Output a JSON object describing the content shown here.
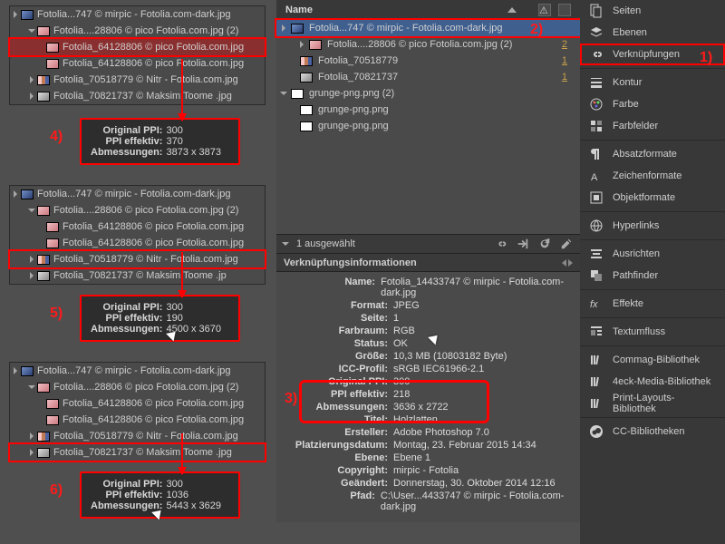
{
  "left": {
    "box1": {
      "rows": [
        {
          "t": "Fotolia...747 © mirpic - Fotolia.com-dark.jpg",
          "th": "blue",
          "disc": true
        },
        {
          "t": "Fotolia....28806 © pico Fotolia.com.jpg (2)",
          "th": "pink",
          "disc": true,
          "open": true,
          "child": true
        },
        {
          "t": "Fotolia_64128806 © pico Fotolia.com.jpg",
          "th": "pink",
          "child2": true,
          "sel": true
        },
        {
          "t": "Fotolia_64128806 © pico Fotolia.com.jpg",
          "th": "pink",
          "child2": true
        },
        {
          "t": "Fotolia_70518779 © Nitr - Fotolia.com.jpg",
          "th": "mix",
          "child": true,
          "disc": true
        },
        {
          "t": "Fotolia_70821737 © Maksim Toome .jpg",
          "th": "gray",
          "child": true,
          "disc": true
        }
      ],
      "tip": {
        "ppi": "300",
        "eff": "370",
        "dim": "3873 x 3873"
      },
      "num": "4)"
    },
    "box2": {
      "rows": [
        {
          "t": "Fotolia...747 © mirpic - Fotolia.com-dark.jpg",
          "th": "blue",
          "disc": true
        },
        {
          "t": "Fotolia....28806 © pico Fotolia.com.jpg (2)",
          "th": "pink",
          "disc": true,
          "open": true,
          "child": true
        },
        {
          "t": "Fotolia_64128806 © pico Fotolia.com.jpg",
          "th": "pink",
          "child2": true
        },
        {
          "t": "Fotolia_64128806 © pico Fotolia.com.jpg",
          "th": "pink",
          "child2": true
        },
        {
          "t": "Fotolia_70518779 © Nitr - Fotolia.com.jpg",
          "th": "mix",
          "child": true,
          "disc": true,
          "sel": true
        },
        {
          "t": "Fotolia_70821737 © Maksim Toome .jp",
          "th": "gray",
          "child": true,
          "disc": true
        }
      ],
      "tip": {
        "ppi": "300",
        "eff": "190",
        "dim": "4500 x 3670"
      },
      "num": "5)"
    },
    "box3": {
      "rows": [
        {
          "t": "Fotolia...747 © mirpic - Fotolia.com-dark.jpg",
          "th": "blue",
          "disc": true
        },
        {
          "t": "Fotolia....28806 © pico Fotolia.com.jpg (2)",
          "th": "pink",
          "disc": true,
          "open": true,
          "child": true
        },
        {
          "t": "Fotolia_64128806 © pico Fotolia.com.jpg",
          "th": "pink",
          "child2": true
        },
        {
          "t": "Fotolia_64128806 © pico Fotolia.com.jpg",
          "th": "pink",
          "child2": true
        },
        {
          "t": "Fotolia_70518779 © Nitr - Fotolia.com.jpg",
          "th": "mix",
          "child": true,
          "disc": true
        },
        {
          "t": "Fotolia_70821737 © Maksim Toome .jpg",
          "th": "gray",
          "child": true,
          "disc": true,
          "sel": true
        }
      ],
      "tip": {
        "ppi": "300",
        "eff": "1036",
        "dim": "5443 x 3629"
      },
      "num": "6)"
    },
    "labels": {
      "ppi": "Original PPI:",
      "eff": "PPI effektiv:",
      "dim": "Abmessungen:"
    }
  },
  "mid": {
    "header": "Name",
    "rows": [
      {
        "t": "Fotolia...747 © mirpic - Fotolia.com-dark.jpg",
        "th": "blue",
        "sel": true,
        "disc": true
      },
      {
        "t": "Fotolia....28806 © pico Fotolia.com.jpg (2)",
        "th": "pink",
        "disc": true,
        "child": true,
        "n": "2"
      },
      {
        "t": "Fotolia_70518779",
        "th": "mix",
        "child": true,
        "n": "1"
      },
      {
        "t": "Fotolia_70821737",
        "th": "gray",
        "child": true,
        "n": "1"
      },
      {
        "t": "grunge-png.png (2)",
        "th": "bw",
        "disc": true,
        "open": true
      },
      {
        "t": "grunge-png.png",
        "th": "bw",
        "child": true
      },
      {
        "t": "grunge-png.png",
        "th": "bw",
        "child": true
      }
    ],
    "status": "1 ausgewählt",
    "info_title": "Verknüpfungsinformationen",
    "info": [
      {
        "k": "Name:",
        "v": "Fotolia_14433747 © mirpic - Fotolia.com-dark.jpg"
      },
      {
        "k": "Format:",
        "v": "JPEG"
      },
      {
        "k": "Seite:",
        "v": "1"
      },
      {
        "k": "Farbraum:",
        "v": "RGB"
      },
      {
        "k": "Status:",
        "v": "OK"
      },
      {
        "k": "Größe:",
        "v": "10,3 MB (10803182 Byte)"
      },
      {
        "k": "ICC-Profil:",
        "v": "sRGB IEC61966-2.1"
      },
      {
        "k": "Original PPI:",
        "v": "300",
        "hl": true
      },
      {
        "k": "PPI effektiv:",
        "v": "218",
        "hl": true
      },
      {
        "k": "Abmessungen:",
        "v": "3636 x 2722",
        "hl": true
      },
      {
        "k": "Titel:",
        "v": "Holzlatten"
      },
      {
        "k": "Ersteller:",
        "v": "Adobe Photoshop 7.0"
      },
      {
        "k": "Platzierungsdatum:",
        "v": "Montag, 23. Februar 2015 14:34"
      },
      {
        "k": "Ebene:",
        "v": "Ebene 1"
      },
      {
        "k": "Copyright:",
        "v": "mirpic - Fotolia"
      },
      {
        "k": "Geändert:",
        "v": "Donnerstag, 30. Oktober 2014 12:16"
      },
      {
        "k": "Pfad:",
        "v": "C:\\User...4433747 © mirpic - Fotolia.com-dark.jpg"
      }
    ],
    "num2": "2)",
    "num3": "3)"
  },
  "right": {
    "items": [
      {
        "t": "Seiten",
        "i": "pages"
      },
      {
        "t": "Ebenen",
        "i": "layers"
      },
      {
        "t": "Verknüpfungen",
        "i": "links",
        "sel": true
      },
      {
        "sep": true
      },
      {
        "t": "Kontur",
        "i": "stroke"
      },
      {
        "t": "Farbe",
        "i": "color"
      },
      {
        "t": "Farbfelder",
        "i": "swatch"
      },
      {
        "sep": true
      },
      {
        "t": "Absatzformate",
        "i": "para"
      },
      {
        "t": "Zeichenformate",
        "i": "char"
      },
      {
        "t": "Objektformate",
        "i": "obj"
      },
      {
        "sep": true
      },
      {
        "t": "Hyperlinks",
        "i": "hyper"
      },
      {
        "sep": true
      },
      {
        "t": "Ausrichten",
        "i": "align"
      },
      {
        "t": "Pathfinder",
        "i": "path"
      },
      {
        "sep": true
      },
      {
        "t": "Effekte",
        "i": "fx"
      },
      {
        "sep": true
      },
      {
        "t": "Textumfluss",
        "i": "wrap"
      },
      {
        "sep": true
      },
      {
        "t": "Commag-Bibliothek",
        "i": "lib"
      },
      {
        "t": "4eck-Media-Bibliothek",
        "i": "lib"
      },
      {
        "t": "Print-Layouts-Bibliothek",
        "i": "lib"
      },
      {
        "sep": true
      },
      {
        "t": "CC-Bibliotheken",
        "i": "cc"
      }
    ],
    "num1": "1)"
  }
}
